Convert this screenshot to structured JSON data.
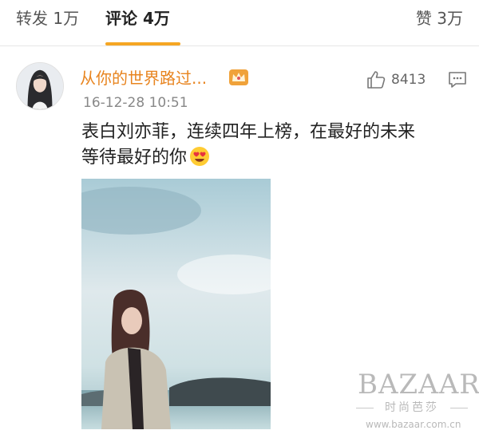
{
  "tabs": {
    "repost": "转发 1万",
    "comments": "评论 4万",
    "likes": "赞 3万",
    "active_color": "#f5a623"
  },
  "comment": {
    "username": "从你的世界路过...",
    "username_color": "#e8841f",
    "badge_icon": "crown-icon",
    "timestamp": "16-12-28 10:51",
    "like_count": "8413",
    "like_icon": "thumb-up-icon",
    "reply_icon": "comment-icon",
    "text_line1": "表白刘亦菲，连续四年上榜，在最好的未来",
    "text_line2": "等待最好的你",
    "emoji": "heart-eyes-emoji"
  },
  "watermark": {
    "logo": "BAZAAR",
    "chinese": "时尚芭莎",
    "url": "www.bazaar.com.cn"
  }
}
